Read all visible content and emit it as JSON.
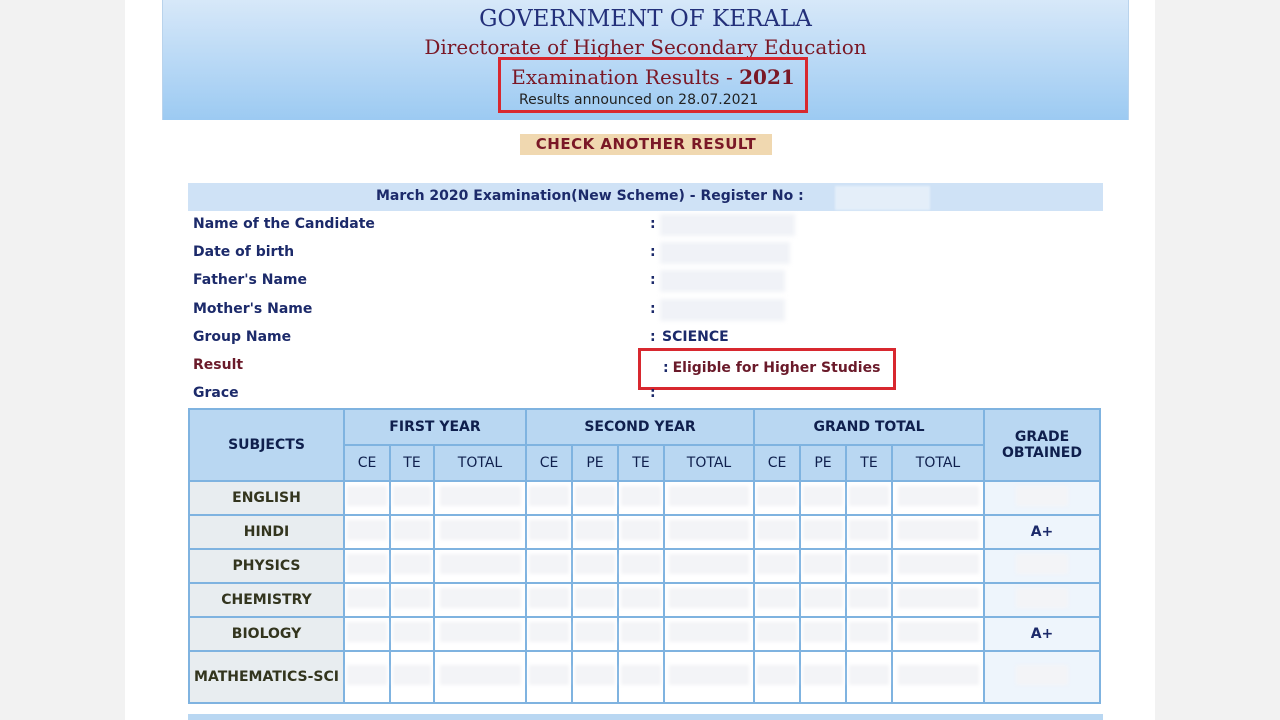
{
  "header": {
    "gov": "GOVERNMENT OF KERALA",
    "directorate": "Directorate of Higher Secondary Education",
    "exam_title": "Examination Results - ",
    "exam_year": "2021",
    "announced": "Results announced on 28.07.2021"
  },
  "check_button": "CHECK ANOTHER RESULT",
  "register_bar": "March 2020 Examination(New Scheme) - Register No :",
  "details": {
    "name_label": "Name of the Candidate",
    "dob_label": "Date of birth",
    "father_label": "Father's Name",
    "mother_label": "Mother's Name",
    "group_label": "Group Name",
    "group_value": "SCIENCE",
    "result_label": "Result",
    "result_value": "Eligible for Higher Studies",
    "grace_label": "Grace",
    "colon": ":"
  },
  "table": {
    "subjects_header": "SUBJECTS",
    "first_year": "FIRST YEAR",
    "second_year": "SECOND YEAR",
    "grand_total": "GRAND TOTAL",
    "grade_obtained": "GRADE OBTAINED",
    "sub_ce": "CE",
    "sub_te": "TE",
    "sub_pe": "PE",
    "sub_total": "TOTAL",
    "rows": [
      {
        "subject": "ENGLISH",
        "grade": ""
      },
      {
        "subject": "HINDI",
        "grade": "A+"
      },
      {
        "subject": "PHYSICS",
        "grade": ""
      },
      {
        "subject": "CHEMISTRY",
        "grade": ""
      },
      {
        "subject": "BIOLOGY",
        "grade": "A+"
      },
      {
        "subject": "MATHEMATICS-SCI",
        "grade": ""
      }
    ]
  }
}
